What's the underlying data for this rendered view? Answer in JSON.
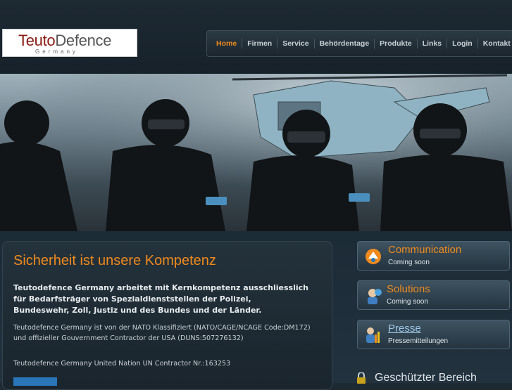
{
  "logo": {
    "part1": "Teuto",
    "part2": "Defence",
    "sub": "Germany"
  },
  "nav": [
    "Home",
    "Firmen",
    "Service",
    "Behördentage",
    "Produkte",
    "Links",
    "Login",
    "Kontakt"
  ],
  "main": {
    "title": "Sicherheit ist unsere Kompetenz",
    "intro": "Teutodefence Germany arbeitet mit Kernkompetenz ausschliesslich für Bedarfsträger von Spezialdienststellen der Polizei, Bundeswehr, Zoll, Justiz und des Bundes und der Länder.",
    "p1": "Teutodefence Germany ist von der NATO Klassifiziert (NATO/CAGE/NCAGE Code:DM172) und offizieller Gouvernment Contractor der USA (DUNS:507276132)",
    "p2": "Teutodefence  Germany United Nation UN Contractor Nr.:163253"
  },
  "sidebar": {
    "cards": [
      {
        "title": "Communication",
        "sub": "Coming soon",
        "icon": "communication-icon"
      },
      {
        "title": "Solutions",
        "sub": "Coming soon",
        "icon": "solutions-icon"
      },
      {
        "title": "Presse",
        "sub": "Pressemitteilungen",
        "icon": "presse-icon"
      }
    ],
    "secure": "Geschützter Bereich"
  },
  "colors": {
    "accent": "#f08a1c",
    "link": "#9fc9e8",
    "background": "#1c2b36"
  }
}
